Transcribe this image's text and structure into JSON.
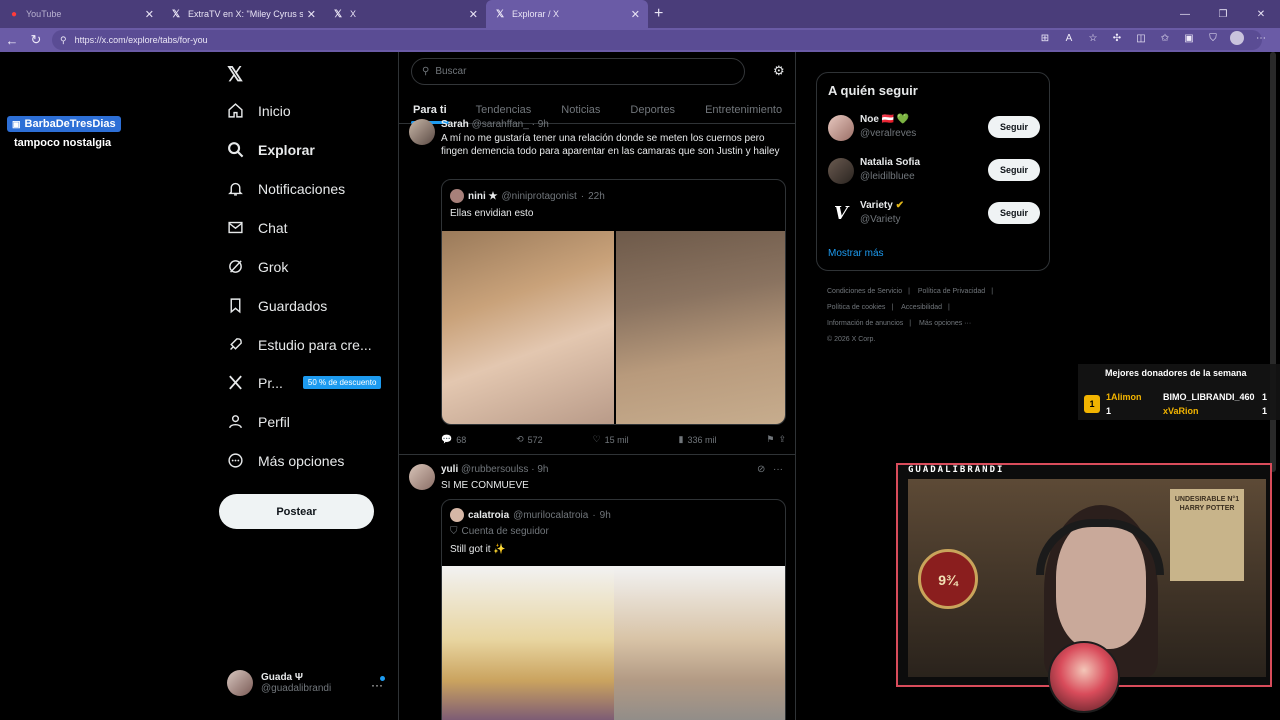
{
  "browser": {
    "tabs": [
      {
        "title": "YouTube",
        "icon": "youtube-icon"
      },
      {
        "title": "ExtraTV en X: \"Miley Cyrus says #l",
        "icon": "x-icon"
      },
      {
        "title": "X",
        "icon": "x-icon"
      },
      {
        "title": "Explorar / X",
        "icon": "x-icon",
        "active": true
      }
    ],
    "url": "https://x.com/explore/tabs/for-you"
  },
  "nav": {
    "items": [
      {
        "label": "Inicio",
        "icon": "home-icon"
      },
      {
        "label": "Explorar",
        "icon": "search-icon",
        "active": true
      },
      {
        "label": "Notificaciones",
        "icon": "bell-icon"
      },
      {
        "label": "Chat",
        "icon": "mail-icon"
      },
      {
        "label": "Grok",
        "icon": "grok-icon"
      },
      {
        "label": "Guardados",
        "icon": "bookmark-icon"
      },
      {
        "label": "Estudio para cre...",
        "icon": "rocket-icon"
      },
      {
        "label": "Pr...",
        "icon": "x-icon",
        "badge": "50 % de descuento"
      },
      {
        "label": "Perfil",
        "icon": "person-icon"
      },
      {
        "label": "Más opciones",
        "icon": "more-icon"
      }
    ],
    "post_button": "Postear",
    "account": {
      "name": "Guada Ψ",
      "handle": "@guadalibrandi"
    }
  },
  "explore": {
    "search_placeholder": "Buscar",
    "tabs": [
      "Para ti",
      "Tendencias",
      "Noticias",
      "Deportes",
      "Entretenimiento"
    ]
  },
  "posts": [
    {
      "author": "Sarah",
      "handle": "@sarahffan_",
      "time": "9h",
      "text": "A mí no me gustaría tener una relación donde se meten los cuernos pero fingen demencia todo para aparentar en las camaras que son Justin y hailey",
      "quote": {
        "author": "nini ★",
        "handle": "@niniprotagonist",
        "time": "22h",
        "text": "Ellas envidian esto"
      },
      "stats": {
        "replies": "68",
        "reposts": "572",
        "likes": "15 mil",
        "views": "336 mil"
      }
    },
    {
      "author": "yuli",
      "handle": "@rubbersoulss",
      "time": "9h",
      "text": "SI ME CONMUEVE",
      "quote": {
        "author": "calatroia",
        "handle": "@murilocalatroia",
        "time": "9h",
        "label": "Cuenta de seguidor",
        "text": "Still got it ✨"
      }
    }
  ],
  "who_to_follow": {
    "title": "A quién seguir",
    "users": [
      {
        "name": "Noe 🇦🇹 💚",
        "handle": "@veralreves",
        "button": "Seguir"
      },
      {
        "name": "Natalia Sofia",
        "handle": "@leidilbluee",
        "button": "Seguir"
      },
      {
        "name": "Variety",
        "handle": "@Variety",
        "button": "Seguir"
      }
    ],
    "more": "Mostrar más"
  },
  "footer": [
    "Condiciones de Servicio",
    "Política de Privacidad",
    "Política de cookies",
    "Accesibilidad",
    "Información de anuncios",
    "Más opciones ···",
    "© 2026 X Corp."
  ],
  "overlay": {
    "chat_user": "BarbaDeTresDias",
    "chat_message": "tampoco nostalgia",
    "donors_title": "Mejores donadores de la semana",
    "donors": [
      {
        "name": "1Alimon",
        "count": "1"
      },
      {
        "name": "BIMO_LIBRANDI_460",
        "count": "1"
      },
      {
        "name": "xVaRion",
        "count": "1"
      }
    ],
    "cam_label": "GUADALIBRANDI",
    "poster_text": "UNDESIRABLE N°1 HARRY POTTER",
    "platform_text": "9¾"
  },
  "colors": {
    "accent": "#1d9bf0",
    "browser": "#6a5ba6",
    "cam_border": "#d94c5b"
  }
}
